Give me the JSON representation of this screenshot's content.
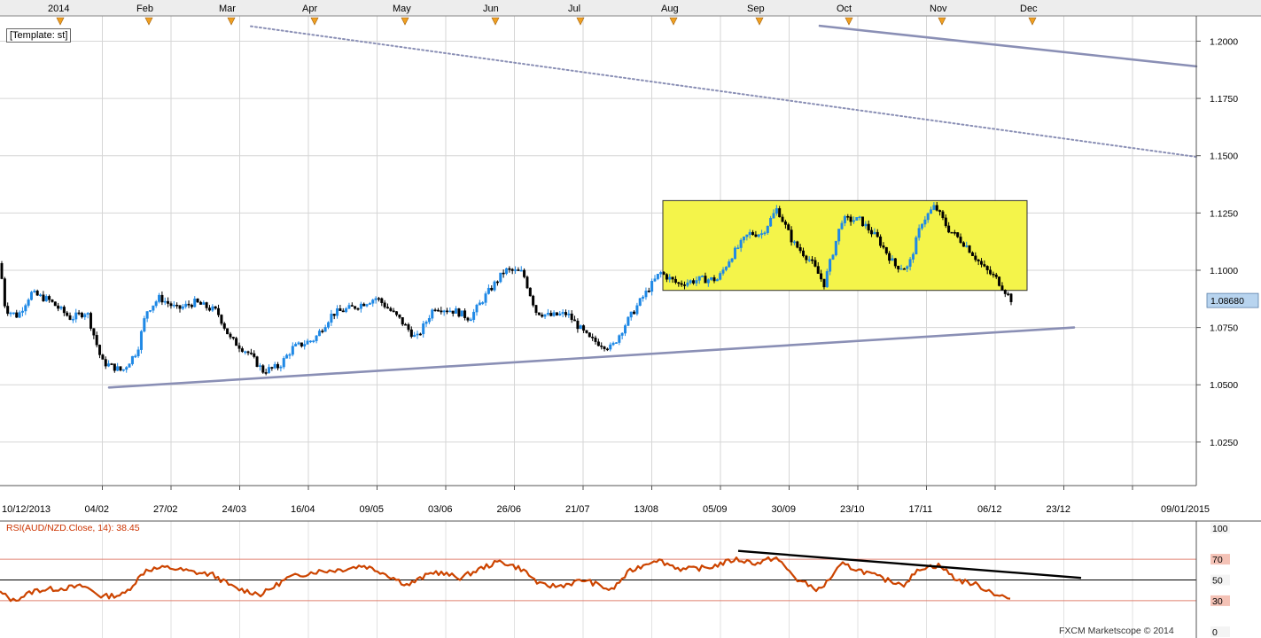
{
  "chart_data": [
    {
      "type": "candlestick",
      "template_label": "[Template: st]",
      "months_axis": [
        "2014",
        "Feb",
        "Mar",
        "Apr",
        "May",
        "Jun",
        "Jul",
        "Aug",
        "Sep",
        "Oct",
        "Nov",
        "Dec"
      ],
      "x_tick_labels": [
        "10/12/2013",
        "04/02",
        "27/02",
        "24/03",
        "16/04",
        "09/05",
        "03/06",
        "26/06",
        "21/07",
        "13/08",
        "05/09",
        "30/09",
        "23/10",
        "17/11",
        "06/12",
        "23/12",
        "09/01/2015"
      ],
      "y_tick_labels": [
        "1.0250",
        "1.0500",
        "1.0750",
        "1.1000",
        "1.1250",
        "1.1500",
        "1.1750",
        "1.2000"
      ],
      "ylim": [
        1.006,
        1.211
      ],
      "current_price": "1.08680",
      "grid": true,
      "anchors": [
        {
          "x": 0,
          "y": 1.103
        },
        {
          "x": 6,
          "y": 1.083
        },
        {
          "x": 20,
          "y": 1.08
        },
        {
          "x": 35,
          "y": 1.09
        },
        {
          "x": 55,
          "y": 1.087
        },
        {
          "x": 80,
          "y": 1.079
        },
        {
          "x": 98,
          "y": 1.082
        },
        {
          "x": 115,
          "y": 1.06
        },
        {
          "x": 138,
          "y": 1.056
        },
        {
          "x": 155,
          "y": 1.065
        },
        {
          "x": 165,
          "y": 1.082
        },
        {
          "x": 180,
          "y": 1.088
        },
        {
          "x": 200,
          "y": 1.083
        },
        {
          "x": 220,
          "y": 1.086
        },
        {
          "x": 245,
          "y": 1.082
        },
        {
          "x": 260,
          "y": 1.07
        },
        {
          "x": 280,
          "y": 1.064
        },
        {
          "x": 297,
          "y": 1.056
        },
        {
          "x": 315,
          "y": 1.058
        },
        {
          "x": 330,
          "y": 1.066
        },
        {
          "x": 355,
          "y": 1.07
        },
        {
          "x": 375,
          "y": 1.081
        },
        {
          "x": 400,
          "y": 1.084
        },
        {
          "x": 425,
          "y": 1.088
        },
        {
          "x": 450,
          "y": 1.079
        },
        {
          "x": 470,
          "y": 1.07
        },
        {
          "x": 490,
          "y": 1.084
        },
        {
          "x": 515,
          "y": 1.082
        },
        {
          "x": 530,
          "y": 1.079
        },
        {
          "x": 550,
          "y": 1.09
        },
        {
          "x": 570,
          "y": 1.1
        },
        {
          "x": 590,
          "y": 1.099
        },
        {
          "x": 605,
          "y": 1.082
        },
        {
          "x": 620,
          "y": 1.08
        },
        {
          "x": 640,
          "y": 1.081
        },
        {
          "x": 665,
          "y": 1.07
        },
        {
          "x": 690,
          "y": 1.066
        },
        {
          "x": 705,
          "y": 1.076
        },
        {
          "x": 725,
          "y": 1.088
        },
        {
          "x": 745,
          "y": 1.099
        },
        {
          "x": 765,
          "y": 1.094
        },
        {
          "x": 790,
          "y": 1.096
        },
        {
          "x": 810,
          "y": 1.096
        },
        {
          "x": 825,
          "y": 1.106
        },
        {
          "x": 845,
          "y": 1.116
        },
        {
          "x": 860,
          "y": 1.116
        },
        {
          "x": 877,
          "y": 1.127
        },
        {
          "x": 895,
          "y": 1.112
        },
        {
          "x": 915,
          "y": 1.104
        },
        {
          "x": 930,
          "y": 1.094
        },
        {
          "x": 950,
          "y": 1.122
        },
        {
          "x": 970,
          "y": 1.122
        },
        {
          "x": 990,
          "y": 1.114
        },
        {
          "x": 1010,
          "y": 1.102
        },
        {
          "x": 1025,
          "y": 1.101
        },
        {
          "x": 1040,
          "y": 1.121
        },
        {
          "x": 1055,
          "y": 1.128
        },
        {
          "x": 1070,
          "y": 1.118
        },
        {
          "x": 1090,
          "y": 1.111
        },
        {
          "x": 1110,
          "y": 1.101
        },
        {
          "x": 1125,
          "y": 1.096
        },
        {
          "x": 1142,
          "y": 1.0868
        }
      ],
      "range_box": {
        "x_start": 748,
        "x_end": 1159,
        "y_low": 1.0912,
        "y_high": 1.1304
      },
      "trendlines": [
        {
          "style": "solid",
          "points": [
            [
              123,
              1.0488
            ],
            [
              1212,
              1.075
            ]
          ]
        },
        {
          "style": "dotted",
          "points": [
            [
              283,
              1.2065
            ],
            [
              1350,
              1.1495
            ]
          ]
        },
        {
          "style": "solid",
          "points": [
            [
              925,
              1.2067
            ],
            [
              1350,
              1.189
            ]
          ]
        }
      ]
    },
    {
      "type": "line",
      "name": "RSI",
      "title": "RSI(AUD/NZD.Close, 14): 38.45",
      "ylim": [
        0,
        100
      ],
      "y_tick_labels": [
        "100",
        "70",
        "50",
        "30",
        "0"
      ],
      "levels": [
        30,
        50,
        70
      ],
      "anchors": [
        {
          "x": 0,
          "y": 38
        },
        {
          "x": 15,
          "y": 30
        },
        {
          "x": 40,
          "y": 40
        },
        {
          "x": 70,
          "y": 42
        },
        {
          "x": 95,
          "y": 44
        },
        {
          "x": 115,
          "y": 34
        },
        {
          "x": 140,
          "y": 36
        },
        {
          "x": 165,
          "y": 60
        },
        {
          "x": 190,
          "y": 62
        },
        {
          "x": 215,
          "y": 58
        },
        {
          "x": 240,
          "y": 55
        },
        {
          "x": 265,
          "y": 42
        },
        {
          "x": 295,
          "y": 36
        },
        {
          "x": 325,
          "y": 52
        },
        {
          "x": 355,
          "y": 58
        },
        {
          "x": 385,
          "y": 60
        },
        {
          "x": 410,
          "y": 64
        },
        {
          "x": 430,
          "y": 58
        },
        {
          "x": 460,
          "y": 45
        },
        {
          "x": 490,
          "y": 58
        },
        {
          "x": 520,
          "y": 52
        },
        {
          "x": 545,
          "y": 62
        },
        {
          "x": 565,
          "y": 68
        },
        {
          "x": 590,
          "y": 60
        },
        {
          "x": 610,
          "y": 45
        },
        {
          "x": 630,
          "y": 44
        },
        {
          "x": 660,
          "y": 50
        },
        {
          "x": 690,
          "y": 40
        },
        {
          "x": 710,
          "y": 58
        },
        {
          "x": 740,
          "y": 70
        },
        {
          "x": 770,
          "y": 60
        },
        {
          "x": 800,
          "y": 62
        },
        {
          "x": 830,
          "y": 70
        },
        {
          "x": 855,
          "y": 66
        },
        {
          "x": 875,
          "y": 72
        },
        {
          "x": 900,
          "y": 50
        },
        {
          "x": 925,
          "y": 40
        },
        {
          "x": 950,
          "y": 65
        },
        {
          "x": 975,
          "y": 58
        },
        {
          "x": 1000,
          "y": 50
        },
        {
          "x": 1020,
          "y": 46
        },
        {
          "x": 1040,
          "y": 62
        },
        {
          "x": 1060,
          "y": 64
        },
        {
          "x": 1080,
          "y": 50
        },
        {
          "x": 1100,
          "y": 46
        },
        {
          "x": 1125,
          "y": 36
        },
        {
          "x": 1142,
          "y": 31
        }
      ],
      "trendline": {
        "points": [
          [
            833,
            78
          ],
          [
            1220,
            52
          ]
        ]
      }
    }
  ],
  "footer": {
    "copyright": "FXCM Marketscope © 2014"
  },
  "colors": {
    "bull": "#1e88e5",
    "bear": "#000000",
    "box_fill": "#f4f44a",
    "trendline": "#8a8fb5",
    "rsi_line": "#cc4400",
    "level_line": "#e08070",
    "price_tag": "#b8d4ef"
  }
}
